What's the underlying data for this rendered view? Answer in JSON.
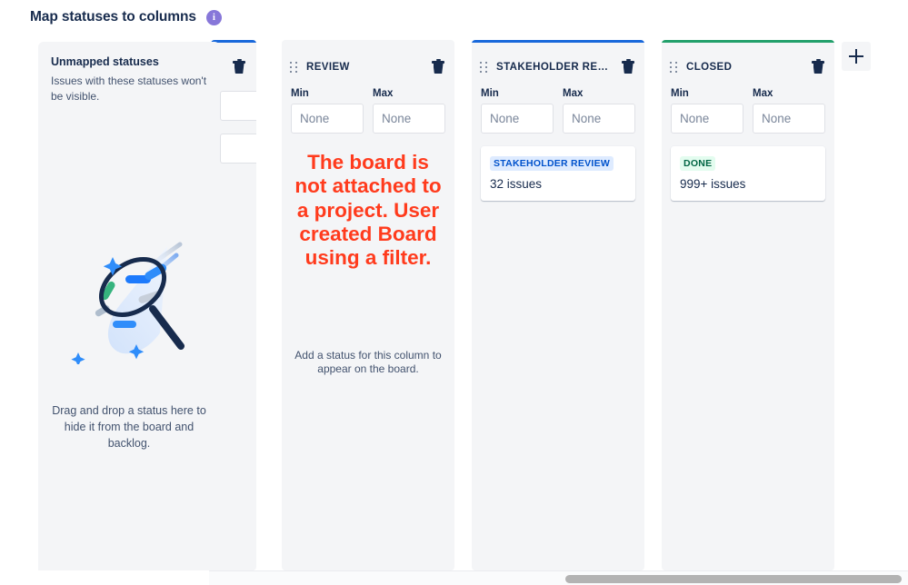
{
  "header": {
    "title": "Map statuses to columns",
    "info_icon": "info-icon",
    "info_glyph": "i"
  },
  "unmapped_panel": {
    "title": "Unmapped statuses",
    "subtitle": "Issues with these statuses won't be visible.",
    "illustration": "magnifying-glass-illustration",
    "hint": "Drag and drop a status here to hide it from the board and backlog."
  },
  "overlay_annotation": {
    "text": "The board is not attached to a project. User created Board using a filter.",
    "color": "#ff3b1d"
  },
  "field_labels": {
    "min": "Min",
    "max": "Max"
  },
  "input_placeholder": "None",
  "columns": [
    {
      "id": "hidden-column",
      "title": "",
      "top_color": "#1868db",
      "partial": true,
      "min": "",
      "max": "",
      "statuses": []
    },
    {
      "id": "review",
      "title": "REVIEW",
      "top_color": "transparent",
      "partial": false,
      "min": "None",
      "max": "None",
      "statuses": [],
      "empty_hint": "Add a status for this column to appear on the board."
    },
    {
      "id": "stakeholder-review",
      "title": "STAKEHOLDER REVI...",
      "top_color": "#1868db",
      "partial": false,
      "min": "None",
      "max": "None",
      "statuses": [
        {
          "badge": "STAKEHOLDER REVIEW",
          "badge_style": "blue",
          "count": "32 issues"
        }
      ]
    },
    {
      "id": "closed",
      "title": "CLOSED",
      "top_color": "#22a06b",
      "partial": false,
      "min": "None",
      "max": "None",
      "statuses": [
        {
          "badge": "DONE",
          "badge_style": "green",
          "count": "999+ issues"
        }
      ]
    }
  ],
  "add_column_button": {
    "label": "+",
    "name": "add-column-button"
  },
  "scrollbar": {
    "orientation": "horizontal",
    "position": "right"
  }
}
